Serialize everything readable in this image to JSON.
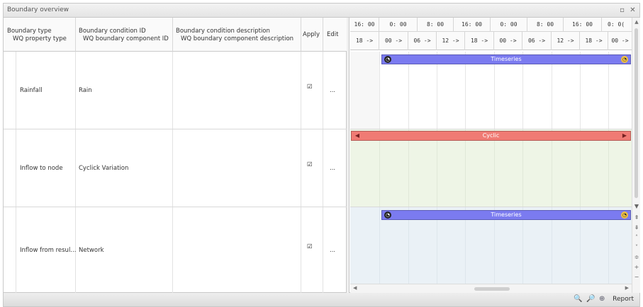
{
  "panel": {
    "title": "Boundary overview"
  },
  "grid": {
    "headers": {
      "c1_line1": "Boundary type",
      "c1_line2": "WQ property type",
      "c2_line1": "Boundary condition ID",
      "c2_line2": "WQ boundary component ID",
      "c3_line1": "Boundary condition description",
      "c3_line2": "WQ boundary component description",
      "apply": "Apply",
      "edit": "Edit"
    },
    "rows": [
      {
        "type": "Rainfall",
        "id": "Rain",
        "description": "",
        "apply": "☑",
        "edit": "..."
      },
      {
        "type": "Inflow to node",
        "id": "Cyclick Variation",
        "description": "",
        "apply": "☑",
        "edit": "..."
      },
      {
        "type": "Inflow from resul...",
        "id": "Network",
        "description": "",
        "apply": "☑",
        "edit": "..."
      }
    ]
  },
  "timeline": {
    "row1": [
      "16: 00",
      "0: 00",
      "8: 00",
      "16: 00",
      "0: 00",
      "8: 00",
      "16: 00",
      "0: 0("
    ],
    "row2": [
      "18 ->",
      "00 ->",
      "06 ->",
      "12 ->",
      "18 ->",
      "00 ->",
      "06 ->",
      "12 ->",
      "18 ->",
      "00 ->"
    ],
    "bars": [
      {
        "label": "Timeseries",
        "color": "#7b7bf0"
      },
      {
        "label": "Cyclic",
        "color": "#f07b74"
      },
      {
        "label": "Timeseries",
        "color": "#7b7bf0"
      }
    ]
  },
  "statusbar": {
    "report": "Report"
  },
  "colors": {
    "timeseries": "#7b7bf0",
    "cyclic": "#f07b74",
    "cyclic_lane": "#eef5e6",
    "network_lane": "#eaf1f6"
  }
}
